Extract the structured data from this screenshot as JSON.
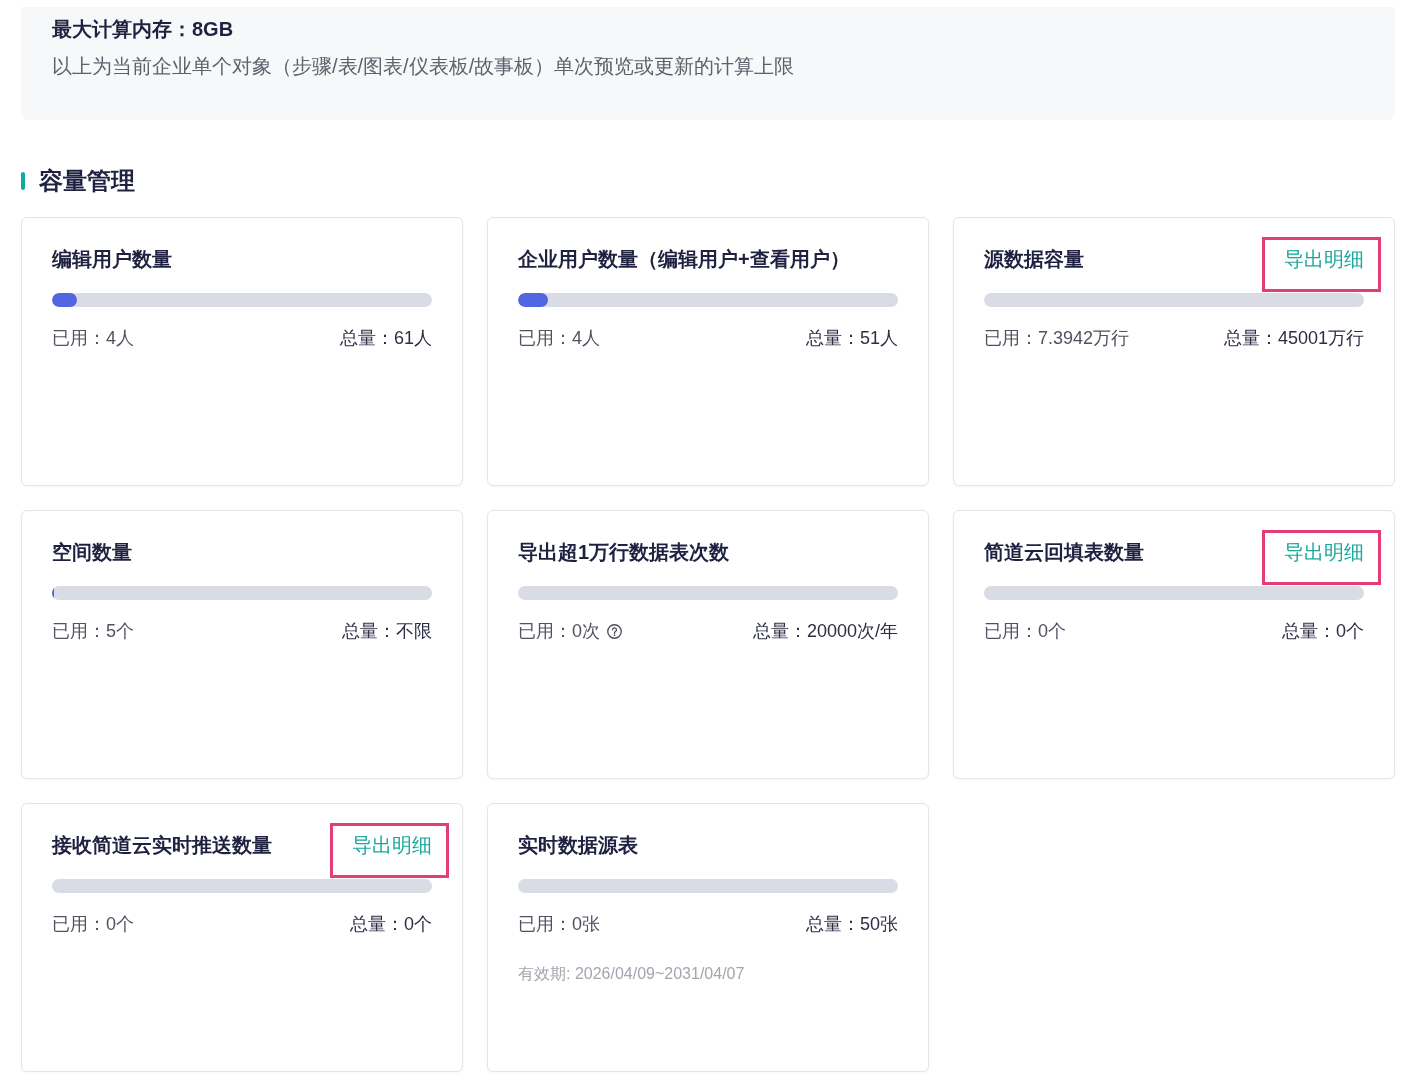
{
  "compute_limits": {
    "max_memory": "最大计算内存：8GB",
    "note": "以上为当前企业单个对象（步骤/表/图表/仪表板/故事板）单次预览或更新的计算上限"
  },
  "capacity": {
    "title": "容量管理",
    "cards": [
      {
        "title": "编辑用户数量",
        "level": 0.066,
        "used": "已用：4人",
        "has_help": false,
        "total": "总量：61人"
      },
      {
        "title": "企业用户数量（编辑用户+查看用户）",
        "level": 0.078,
        "used": "已用：4人",
        "has_help": false,
        "total": "总量：51人"
      },
      {
        "title": "源数据容量",
        "export": {
          "label": "导出明细",
          "highlighted": true
        },
        "used": "已用：7.3942万行",
        "has_help": false,
        "total": "总量：45001万行"
      },
      {
        "title": "空间数量",
        "level": 0.005,
        "used": "已用：5个",
        "has_help": false,
        "total": "总量：不限"
      },
      {
        "title": "导出超1万行数据表次数",
        "used": "已用：0次",
        "has_help": true,
        "total": "总量：20000次/年"
      },
      {
        "title": "简道云回填表数量",
        "export": {
          "label": "导出明细",
          "highlighted": true
        },
        "used": "已用：0个",
        "has_help": false,
        "total": "总量：0个"
      },
      {
        "title": "接收简道云实时推送数量",
        "export": {
          "label": "导出明细",
          "highlighted": true
        },
        "used": "已用：0个",
        "has_help": false,
        "total": "总量：0个"
      },
      {
        "title": "实时数据源表",
        "used": "已用：0张",
        "has_help": false,
        "total": "总量：50张",
        "validity": "有效期: 2026/04/09~2031/04/07"
      }
    ]
  }
}
